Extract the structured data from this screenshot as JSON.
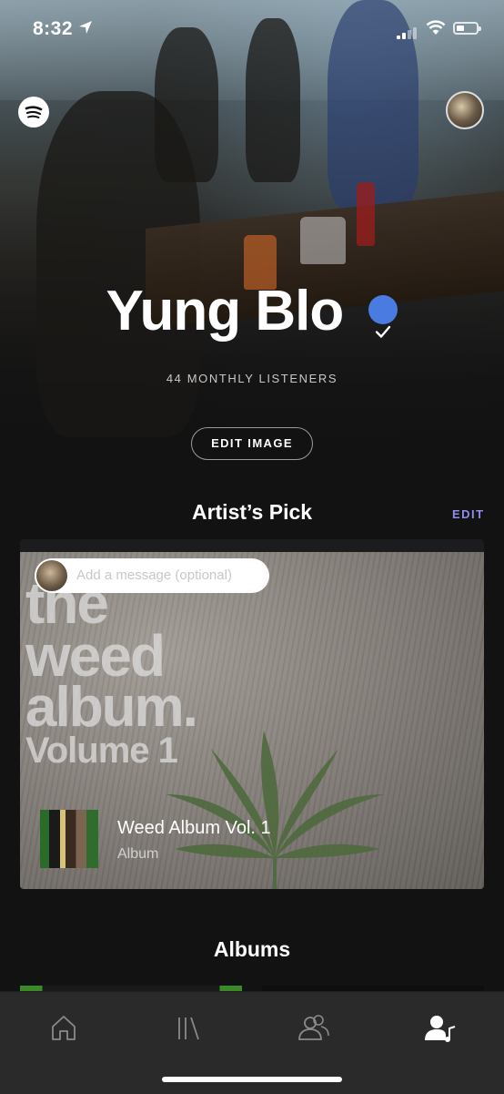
{
  "status_bar": {
    "time": "8:32"
  },
  "artist": {
    "name": "Yung Blo",
    "monthly_listeners": "44 MONTHLY LISTENERS",
    "edit_image_label": "EDIT IMAGE"
  },
  "artists_pick": {
    "title": "Artist’s Pick",
    "edit_label": "EDIT",
    "message_placeholder": "Add a message (optional)",
    "cover_text": [
      "the",
      "weed",
      "album.",
      "Volume 1"
    ],
    "item_title": "Weed Album Vol. 1",
    "item_type": "Album"
  },
  "albums": {
    "title": "Albums"
  },
  "tabs": [
    {
      "name": "home-icon",
      "active": false
    },
    {
      "name": "library-icon",
      "active": false
    },
    {
      "name": "friends-icon",
      "active": false
    },
    {
      "name": "artist-icon",
      "active": true
    }
  ],
  "colors": {
    "background": "#121212",
    "verified": "#4a7be0",
    "edit_link": "#8e8cf0",
    "tabbar": "#2a2a2a"
  }
}
